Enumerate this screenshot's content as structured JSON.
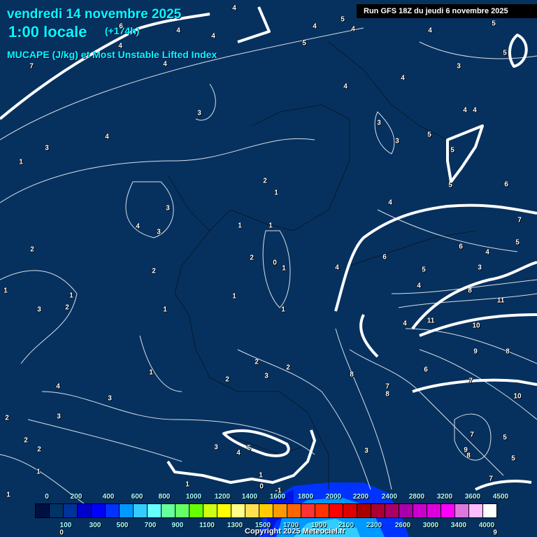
{
  "header": {
    "date": "vendredi 14 novembre 2025",
    "time": "1:00 locale",
    "lead": "(+174h)",
    "parameter": "MUCAPE (J/kg) et Most Unstable Lifted Index",
    "run": "Run GFS 18Z du jeudi 6 novembre 2025"
  },
  "legend": {
    "unit": "J/kg",
    "top_labels": [
      "0",
      "200",
      "400",
      "600",
      "800",
      "1000",
      "1200",
      "1400",
      "1600",
      "1800",
      "2000",
      "2200",
      "2400",
      "2800",
      "3200",
      "3600",
      "4500"
    ],
    "bottom_labels": [
      "100",
      "300",
      "500",
      "700",
      "900",
      "1100",
      "1300",
      "1500",
      "1700",
      "1900",
      "2100",
      "2300",
      "2600",
      "3000",
      "3400",
      "4000"
    ],
    "colors": [
      "#001040",
      "#003366",
      "#003399",
      "#0000cc",
      "#0000ff",
      "#0033ff",
      "#0099ff",
      "#33ccff",
      "#66ffff",
      "#66ff99",
      "#66ff66",
      "#66ff00",
      "#ccff11",
      "#ffff00",
      "#ffff88",
      "#ffe050",
      "#ffcc00",
      "#ff9900",
      "#ff6600",
      "#ff3333",
      "#ff3300",
      "#ff0000",
      "#dd0000",
      "#aa0000",
      "#aa0033",
      "#aa0066",
      "#aa00aa",
      "#cc00cc",
      "#dd00dd",
      "#ff00ff",
      "#dd77dd",
      "#ffbbff",
      "#ffffff"
    ]
  },
  "map": {
    "contour_labels": [
      "4",
      "5",
      "4",
      "4",
      "4",
      "4",
      "5",
      "6",
      "4",
      "7",
      "4",
      "5",
      "4",
      "5",
      "3",
      "4",
      "4",
      "3",
      "4",
      "3",
      "3",
      "3",
      "5",
      "5",
      "5",
      "4",
      "4",
      "6",
      "1",
      "2",
      "1",
      "3",
      "4",
      "3",
      "4",
      "1",
      "1",
      "2",
      "7",
      "5",
      "6",
      "4",
      "2",
      "0",
      "1",
      "4",
      "6",
      "5",
      "3",
      "2",
      "1",
      "1",
      "4",
      "8",
      "3",
      "2",
      "1",
      "1",
      "1",
      "11",
      "4",
      "11",
      "10",
      "9",
      "8",
      "1",
      "2",
      "2",
      "6",
      "8",
      "2",
      "3",
      "7",
      "8",
      "7",
      "4",
      "3",
      "3",
      "10",
      "2",
      "2",
      "2",
      "3",
      "5",
      "4",
      "7",
      "5",
      "9",
      "8",
      "3",
      "5",
      "1",
      "1",
      "1",
      "0",
      "-1",
      "1",
      "7",
      "0",
      "9"
    ]
  },
  "footer": {
    "copyright": "Copyright 2025 Meteociel.fr"
  }
}
